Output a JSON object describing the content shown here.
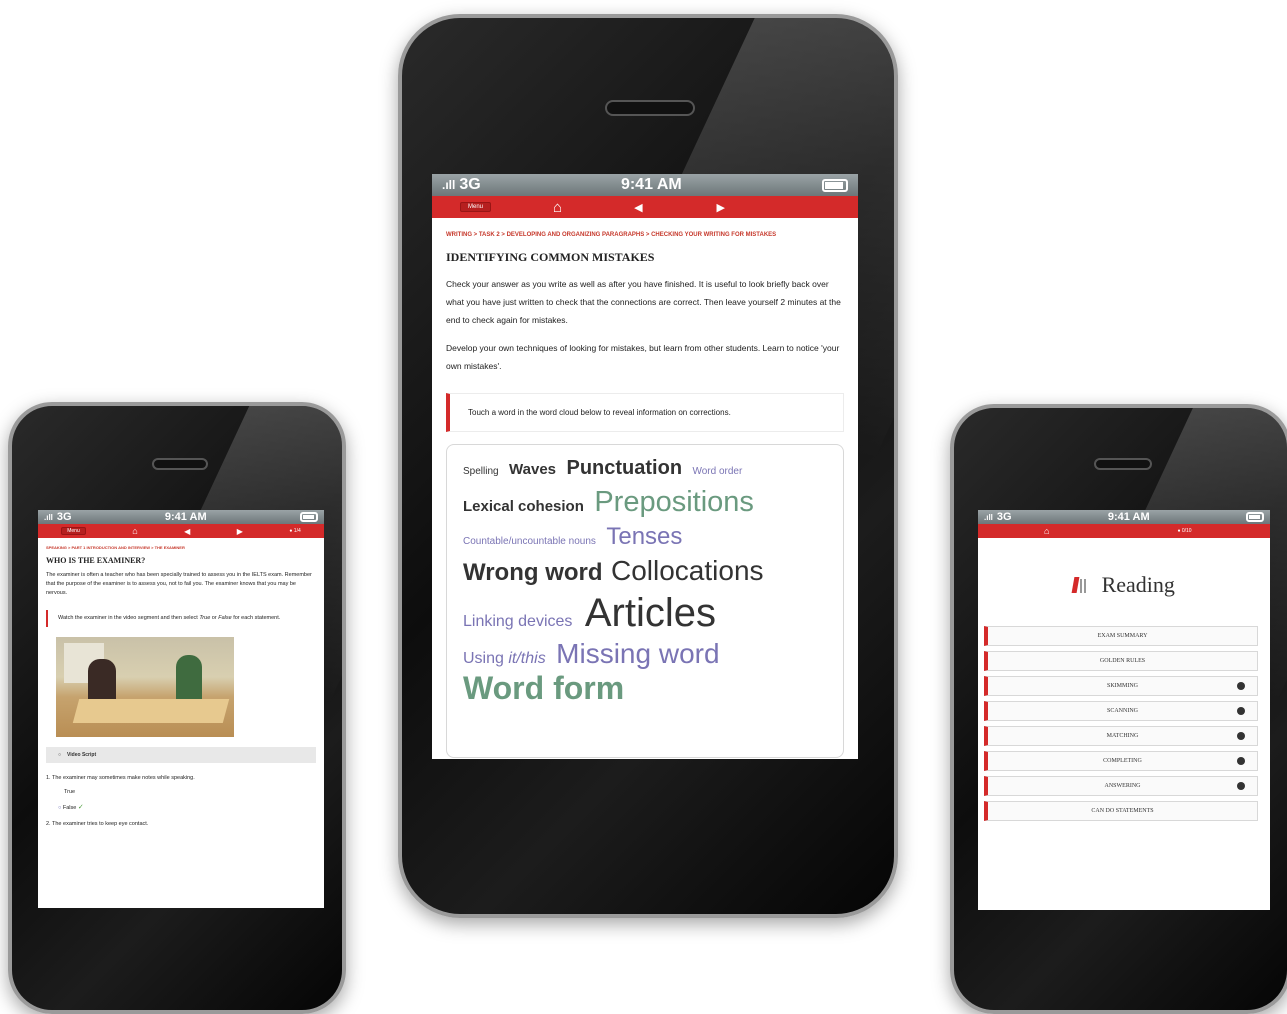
{
  "status": {
    "carrier": "3G",
    "time": "9:41 AM"
  },
  "nav": {
    "menu_label": "Menu",
    "home_icon": "home-icon",
    "back_icon": "arrow-left-icon",
    "forward_icon": "arrow-right-icon",
    "progress_left": "1/4",
    "progress_right": "0/10"
  },
  "center": {
    "breadcrumb": "WRITING > TASK 2 > DEVELOPING AND ORGANIZING PARAGRAPHS > CHECKING YOUR WRITING FOR MISTAKES",
    "title": "IDENTIFYING COMMON MISTAKES",
    "para1": "Check your answer as you write as well as after you have finished. It is useful to look briefly back over what you have just written to check that the connections are correct. Then leave yourself 2 minutes at the end to check again for mistakes.",
    "para2": "Develop your own techniques of looking for mistakes, but learn from other students. Learn to notice 'your own mistakes'.",
    "instruction": "Touch a word in the word cloud below to reveal information on corrections.",
    "cloud": {
      "spelling": "Spelling",
      "waves": "Waves",
      "punctuation": "Punctuation",
      "word_order": "Word order",
      "lexical_cohesion": "Lexical cohesion",
      "prepositions": "Prepositions",
      "countable": "Countable/uncountable nouns",
      "tenses": "Tenses",
      "wrong_word": "Wrong word",
      "collocations": "Collocations",
      "linking_devices": "Linking devices",
      "articles": "Articles",
      "using": "Using",
      "it_this": "it/this",
      "missing_word": "Missing word",
      "word_form": "Word form"
    }
  },
  "left": {
    "breadcrumb": "SPEAKING > PART 1 INTRODUCTION AND INTERVIEW > THE EXAMINER",
    "title": "WHO IS THE EXAMINER?",
    "para": "The examiner is often a teacher who has been specially trained to assess you in the IELTS exam. Remember that the purpose of the examiner is to assess you, not to fail you. The examiner knows that you may be nervous.",
    "instruction_a": "Watch the examiner in the video segment and then select ",
    "instruction_true": "True",
    "instruction_or": " or ",
    "instruction_false": "False",
    "instruction_b": " for each statement.",
    "video_script": "Video Script",
    "q1": "1. The examiner may sometimes make notes while speaking.",
    "opt_true": "True",
    "opt_false": "False",
    "q2": "2. The examiner tries to keep eye contact."
  },
  "right": {
    "heading": "Reading",
    "items": [
      {
        "label": "EXAM SUMMARY",
        "dot": false
      },
      {
        "label": "GOLDEN RULES",
        "dot": false
      },
      {
        "label": "SKIMMING",
        "dot": true
      },
      {
        "label": "SCANNING",
        "dot": true
      },
      {
        "label": "MATCHING",
        "dot": true
      },
      {
        "label": "COMPLETING",
        "dot": true
      },
      {
        "label": "ANSWERING",
        "dot": true
      },
      {
        "label": "CAN DO STATEMENTS",
        "dot": false
      }
    ]
  }
}
